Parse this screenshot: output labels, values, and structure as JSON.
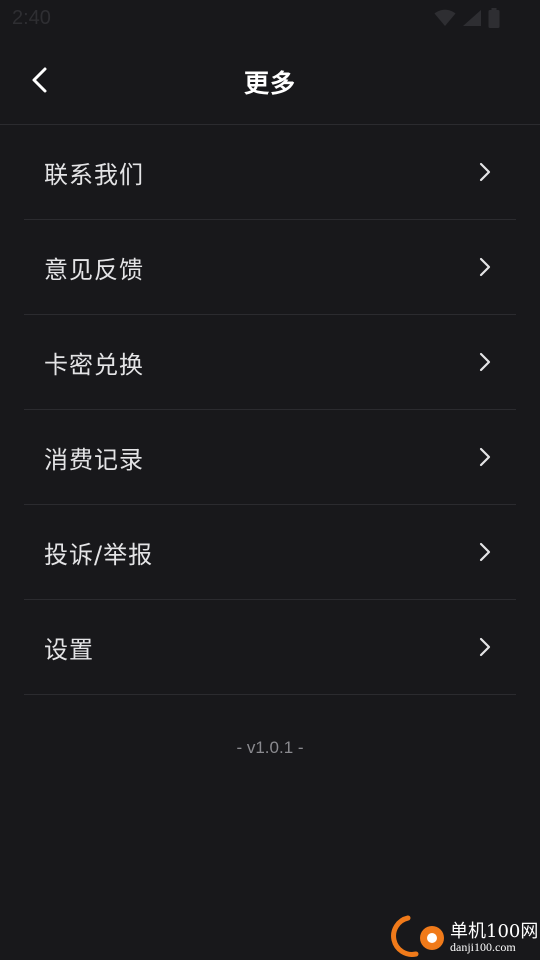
{
  "status_bar": {
    "time": "2:40",
    "icons": [
      "wifi-icon",
      "signal-icon",
      "battery-icon"
    ]
  },
  "header": {
    "title": "更多",
    "back_icon": "chevron-left-icon"
  },
  "menu": {
    "items": [
      {
        "label": "联系我们"
      },
      {
        "label": "意见反馈"
      },
      {
        "label": "卡密兑换"
      },
      {
        "label": "消费记录"
      },
      {
        "label": "投诉/举报"
      },
      {
        "label": "设置"
      }
    ],
    "chevron_icon": "chevron-right-icon"
  },
  "footer": {
    "version": "- v1.0.1 -"
  },
  "watermark": {
    "brand": "单机100网",
    "url": "danji100.com"
  },
  "colors": {
    "background": "#18181b",
    "divider": "#2b2b2f",
    "text_primary": "#e4e4e6",
    "text_secondary": "#8a8a8f",
    "watermark_accent": "#f07a1a"
  }
}
